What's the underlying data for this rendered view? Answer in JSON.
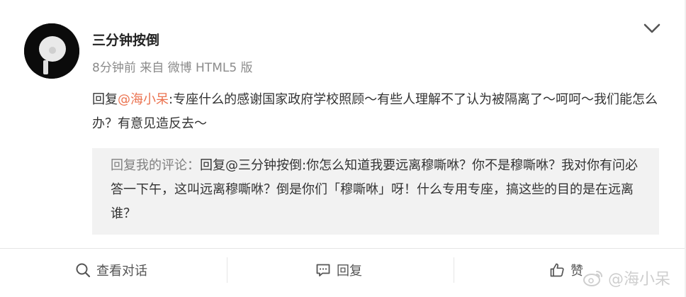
{
  "post": {
    "username": "三分钟按倒",
    "meta": "8分钟前 来自 微博 HTML5 版",
    "reply_prefix": "回复",
    "mention": "@海小呆",
    "body_rest": ":专座什么的感谢国家政府学校照顾～有些人理解不了认为被隔离了～呵呵～我们能怎么办？有意见造反去～"
  },
  "quote": {
    "label": "回复我的评论：",
    "text": "回复@三分钟按倒:你怎么知道我要远离穆嘶咻？你不是穆嘶咻？我对你有问必答一下午，这叫远离穆嘶咻？倒是你们「穆嘶咻」呀！什么专用专座，搞这些的目的是在远离谁？"
  },
  "actions": {
    "view_conversation": "查看对话",
    "reply": "回复",
    "like": "赞"
  },
  "watermark": {
    "text": "@海小呆"
  },
  "colors": {
    "mention": "#eb7350",
    "quote_bg": "#f2f2f2",
    "muted": "#8b8b8b"
  },
  "icons": [
    "avatar",
    "chevron-down-icon",
    "search-icon",
    "comment-icon",
    "thumbs-up-icon",
    "weibo-logo-icon"
  ]
}
